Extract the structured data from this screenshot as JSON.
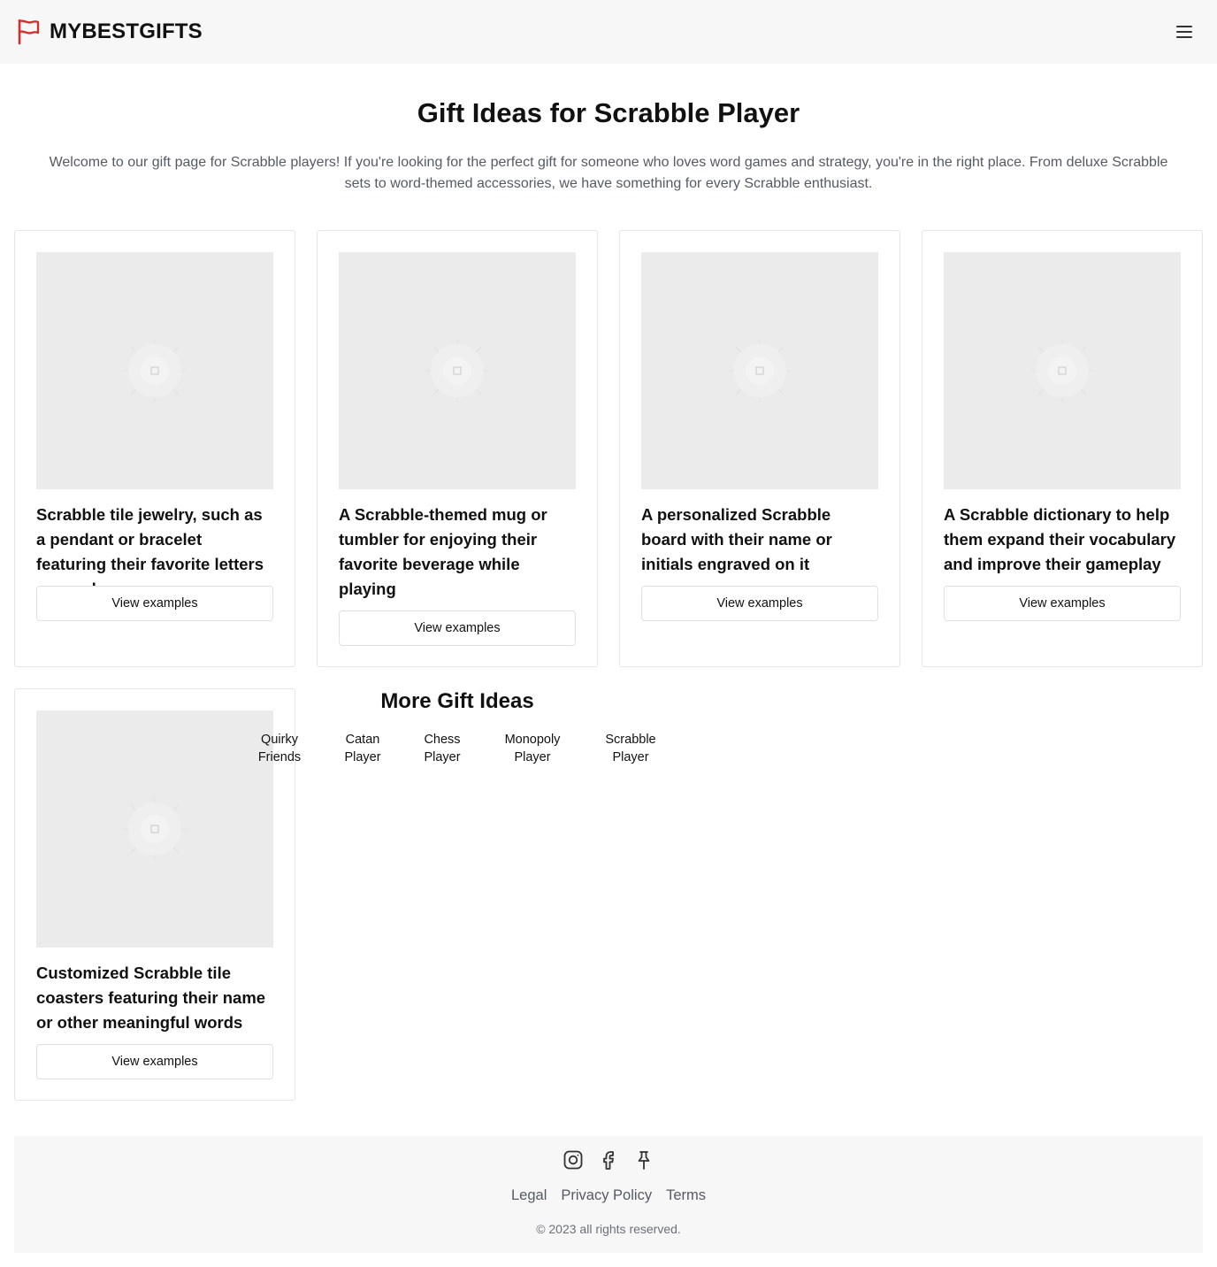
{
  "header": {
    "brand": "MYBESTGIFTS",
    "brand_color": "#d32f2f"
  },
  "page": {
    "title": "Gift Ideas for Scrabble Player",
    "intro": "Welcome to our gift page for Scrabble players! If you're looking for the perfect gift for someone who loves word games and strategy, you're in the right place. From deluxe Scrabble sets to word-themed accessories, we have something for every Scrabble enthusiast."
  },
  "cards": [
    {
      "caption": "Scrabble tile jewelry, such as a pendant or bracelet featuring their favorite letters or words",
      "button": "View examples"
    },
    {
      "caption": "A Scrabble-themed mug or tumbler for enjoying their favorite beverage while playing",
      "button": "View examples"
    },
    {
      "caption": "A personalized Scrabble board with their name or initials engraved on it",
      "button": "View examples"
    },
    {
      "caption": "A Scrabble dictionary to help them expand their vocabulary and improve their gameplay",
      "button": "View examples"
    },
    {
      "caption": "Customized Scrabble tile coasters featuring their name or other meaningful words",
      "button": "View examples"
    }
  ],
  "more": {
    "title": "More Gift Ideas",
    "links": [
      {
        "line1": "Quirky",
        "line2": "Friends"
      },
      {
        "line1": "Catan",
        "line2": "Player"
      },
      {
        "line1": "Chess",
        "line2": "Player"
      },
      {
        "line1": "Monopoly",
        "line2": "Player"
      },
      {
        "line1": "Scrabble",
        "line2": "Player"
      }
    ]
  },
  "footer": {
    "socials": [
      "instagram-icon",
      "facebook-icon",
      "pinterest-icon"
    ],
    "links": [
      "Legal",
      "Privacy Policy",
      "Terms"
    ],
    "copyright": "© 2023 all rights reserved."
  }
}
